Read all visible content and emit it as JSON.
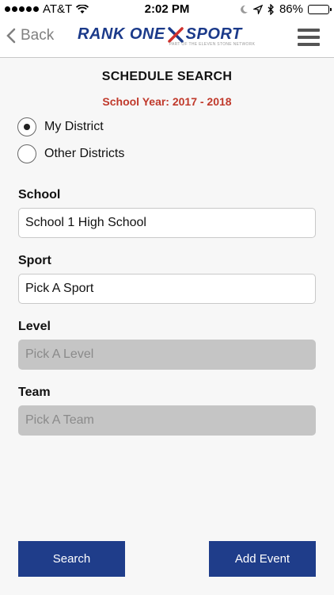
{
  "status_bar": {
    "carrier": "AT&T",
    "time": "2:02 PM",
    "battery_percent": "86%",
    "battery_level": 0.86,
    "icons": [
      "signal-dots-icon",
      "wifi-icon",
      "moon-icon",
      "location-arrow-icon",
      "bluetooth-icon",
      "battery-icon"
    ]
  },
  "nav": {
    "back_label": "Back",
    "logo_text_left": "RANK ONE",
    "logo_text_right": "SPORT",
    "logo_tagline": "PART OF THE ELEVEN STONE NETWORK"
  },
  "page": {
    "title": "SCHEDULE SEARCH",
    "school_year": "School Year: 2017 - 2018"
  },
  "district_options": [
    {
      "label": "My District",
      "selected": true
    },
    {
      "label": "Other Districts",
      "selected": false
    }
  ],
  "fields": {
    "school": {
      "label": "School",
      "value": "School 1 High School"
    },
    "sport": {
      "label": "Sport",
      "value": "Pick A Sport"
    },
    "level": {
      "label": "Level",
      "placeholder": "Pick A Level",
      "enabled": false
    },
    "team": {
      "label": "Team",
      "placeholder": "Pick A Team",
      "enabled": false
    }
  },
  "buttons": {
    "search": "Search",
    "add_event": "Add Event"
  },
  "colors": {
    "accent_blue": "#1f3d8a",
    "year_red": "#c0392b",
    "disabled_gray": "#c5c5c5"
  }
}
